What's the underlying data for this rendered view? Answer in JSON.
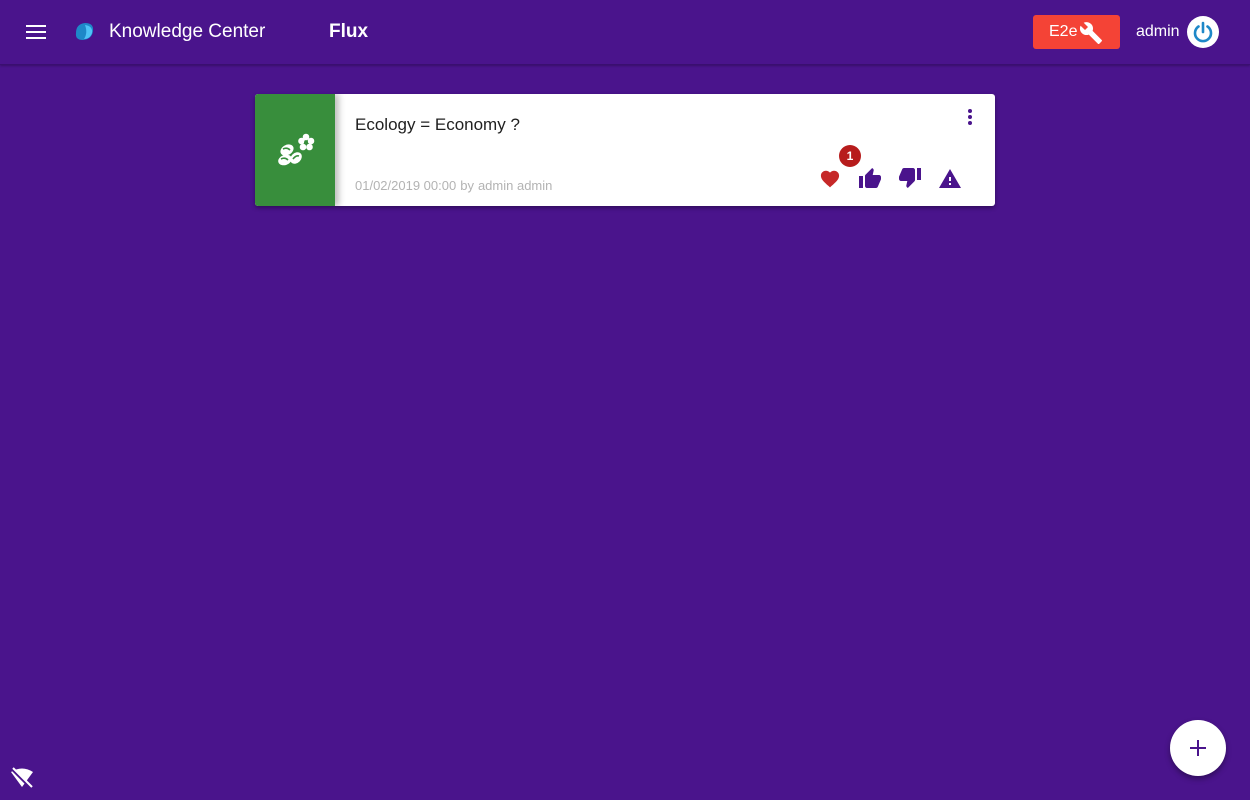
{
  "header": {
    "app_title": "Knowledge Center",
    "page_title": "Flux",
    "env_label": "E2e",
    "user_name": "admin",
    "icons": {
      "menu": "menu-icon",
      "logo": "app-logo",
      "env": "wrench-icon",
      "power": "power-icon"
    }
  },
  "feed": {
    "items": [
      {
        "title": "Ecology = Economy ?",
        "date": "01/02/2019 00:00",
        "by": "by",
        "author": "admin admin",
        "thumbnail_icon": "seeds-icon",
        "thumbnail_color": "#388e3c",
        "likes_count": "1",
        "actions": [
          "heart-icon",
          "thumb-up-icon",
          "thumb-down-icon",
          "warning-icon"
        ],
        "menu_icon": "more-vert-icon"
      }
    ]
  },
  "fab": {
    "icon": "plus-icon"
  },
  "status": {
    "icon": "wifi-off-icon"
  },
  "colors": {
    "background": "#4a148c",
    "accent_red": "#f44336",
    "heart": "#c62828",
    "badge": "#b71c1c",
    "action_purple": "#4a148c",
    "power": "#1e88c8",
    "thumbnail": "#388e3c"
  }
}
